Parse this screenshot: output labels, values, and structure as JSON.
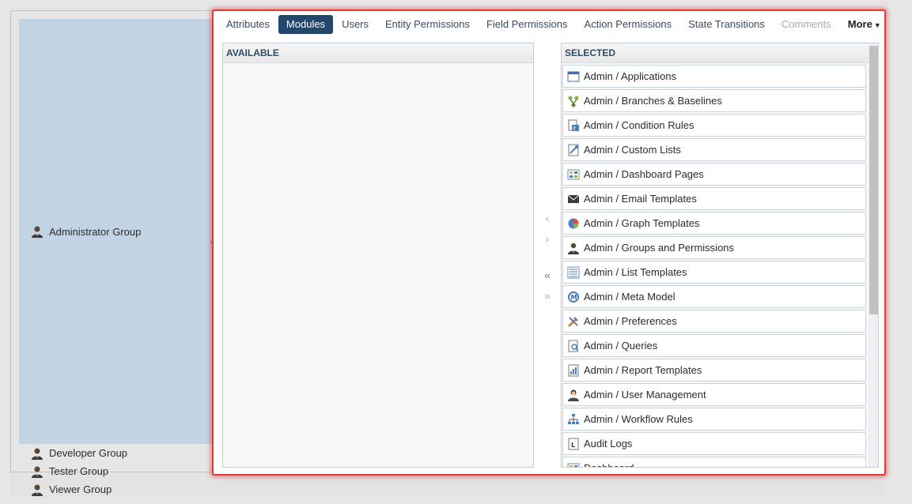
{
  "groups": [
    {
      "label": "Administrator Group",
      "selected": true
    },
    {
      "label": "Developer Group",
      "selected": false
    },
    {
      "label": "Tester Group",
      "selected": false
    },
    {
      "label": "Viewer Group",
      "selected": false
    }
  ],
  "tabs": [
    {
      "label": "Attributes",
      "state": "normal"
    },
    {
      "label": "Modules",
      "state": "active"
    },
    {
      "label": "Users",
      "state": "normal"
    },
    {
      "label": "Entity Permissions",
      "state": "normal"
    },
    {
      "label": "Field Permissions",
      "state": "normal"
    },
    {
      "label": "Action Permissions",
      "state": "normal"
    },
    {
      "label": "State Transitions",
      "state": "normal"
    },
    {
      "label": "Comments",
      "state": "disabled"
    }
  ],
  "more_label": "More",
  "available": {
    "header": "AVAILABLE"
  },
  "selected": {
    "header": "SELECTED",
    "items": [
      {
        "label": "Admin / Applications",
        "icon": "application-window-icon"
      },
      {
        "label": "Admin / Branches & Baselines",
        "icon": "branches-icon"
      },
      {
        "label": "Admin / Condition Rules",
        "icon": "condition-rules-icon"
      },
      {
        "label": "Admin / Custom Lists",
        "icon": "custom-lists-icon"
      },
      {
        "label": "Admin / Dashboard Pages",
        "icon": "dashboard-icon"
      },
      {
        "label": "Admin / Email Templates",
        "icon": "envelope-icon"
      },
      {
        "label": "Admin / Graph Templates",
        "icon": "pie-chart-icon"
      },
      {
        "label": "Admin / Groups and Permissions",
        "icon": "group-user-icon"
      },
      {
        "label": "Admin / List Templates",
        "icon": "list-icon"
      },
      {
        "label": "Admin / Meta Model",
        "icon": "meta-model-icon"
      },
      {
        "label": "Admin / Preferences",
        "icon": "tools-icon"
      },
      {
        "label": "Admin / Queries",
        "icon": "query-document-icon"
      },
      {
        "label": "Admin / Report Templates",
        "icon": "report-chart-icon"
      },
      {
        "label": "Admin / User Management",
        "icon": "user-icon"
      },
      {
        "label": "Admin / Workflow Rules",
        "icon": "workflow-icon"
      },
      {
        "label": "Audit Logs",
        "icon": "audit-log-icon"
      },
      {
        "label": "Dashboard",
        "icon": "dashboard-icon"
      }
    ]
  },
  "transfer_buttons": {
    "move_left": "‹",
    "move_right": "›",
    "move_all_left": "«",
    "move_all_right": "»"
  },
  "colors": {
    "active_tab": "#22466c",
    "highlight_border": "#e23b3b",
    "selected_group": "#c2d3e3"
  }
}
